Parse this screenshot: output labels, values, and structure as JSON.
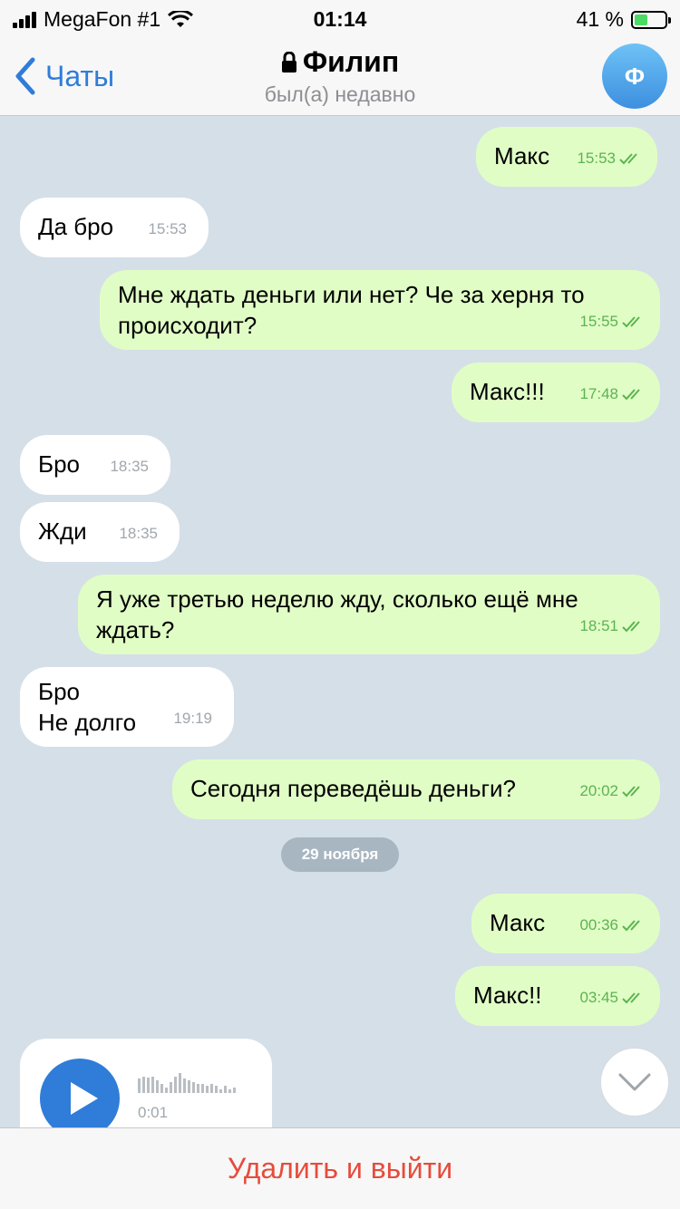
{
  "status_bar": {
    "carrier": "MegaFon #1",
    "time": "01:14",
    "battery": "41 %"
  },
  "nav": {
    "back_label": "Чаты",
    "title": "Филип",
    "subtitle": "был(а) недавно",
    "avatar_letter": "Ф"
  },
  "messages": [
    {
      "dir": "out",
      "lines": [
        "Макс"
      ],
      "time": "15:53"
    },
    {
      "dir": "in",
      "lines": [
        "Да бро"
      ],
      "time": "15:53"
    },
    {
      "dir": "out",
      "lines": [
        "Мне ждать деньги или нет? Че за херня то",
        "происходит?"
      ],
      "time": "15:55"
    },
    {
      "dir": "out",
      "lines": [
        "Макс!!!"
      ],
      "time": "17:48"
    },
    {
      "dir": "in",
      "lines": [
        "Бро"
      ],
      "time": "18:35"
    },
    {
      "dir": "in",
      "lines": [
        "Жди"
      ],
      "time": "18:35"
    },
    {
      "dir": "out",
      "lines": [
        "Я уже третью неделю жду, сколько ещё мне",
        "ждать?"
      ],
      "time": "18:51"
    },
    {
      "dir": "in",
      "lines": [
        "Бро",
        "Не долго"
      ],
      "time": "19:19"
    },
    {
      "dir": "out",
      "lines": [
        "Сегодня переведёшь деньги?"
      ],
      "time": "20:02"
    },
    {
      "dir": "out",
      "lines": [
        "Макс"
      ],
      "time": "00:36"
    },
    {
      "dir": "out",
      "lines": [
        "Макс!!"
      ],
      "time": "03:45"
    }
  ],
  "date_separator": "29 ноября",
  "voice_message": {
    "duration": "0:01"
  },
  "bottom_action": "Удалить и выйти"
}
